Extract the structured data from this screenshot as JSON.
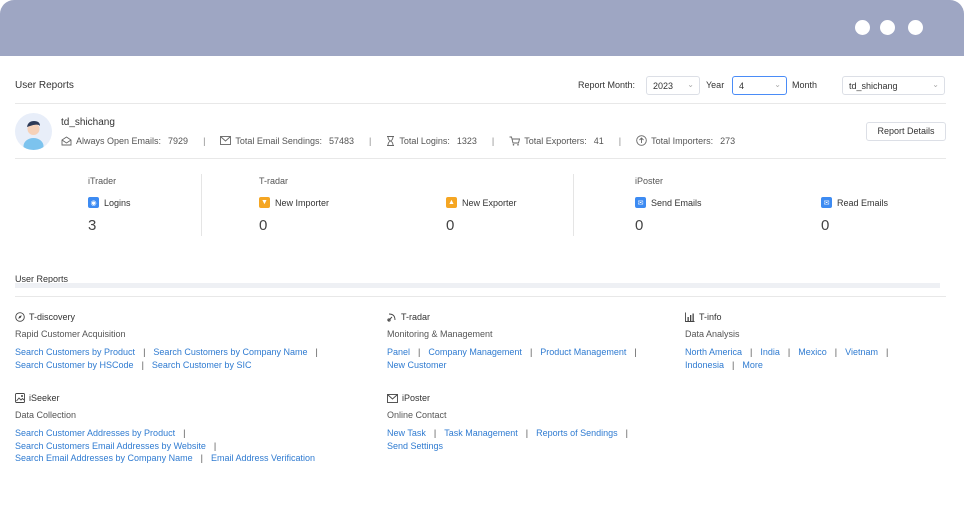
{
  "header": {
    "title": "User Reports",
    "report_month_label": "Report Month:",
    "year_value": "2023",
    "year_label": "Year",
    "month_value": "4",
    "month_label": "Month",
    "user_value": "td_shichang"
  },
  "user": {
    "name": "td_shichang",
    "stats": [
      {
        "label": "Always Open Emails:",
        "value": "7929",
        "icon": "envelope-open-icon"
      },
      {
        "label": "Total Email Sendings:",
        "value": "57483",
        "icon": "envelope-icon"
      },
      {
        "label": "Total Logins:",
        "value": "1323",
        "icon": "hourglass-icon"
      },
      {
        "label": "Total Exporters:",
        "value": "41",
        "icon": "cart-icon"
      },
      {
        "label": "Total Importers:",
        "value": "273",
        "icon": "upload-circle-icon"
      }
    ],
    "report_details_button": "Report Details"
  },
  "metrics": {
    "groups": [
      "iTrader",
      "T-radar",
      "iPoster"
    ],
    "items": [
      {
        "label": "Logins",
        "value": "3",
        "color": "#3d8bf2"
      },
      {
        "label": "New Importer",
        "value": "0",
        "color": "#f5a623"
      },
      {
        "label": "New Exporter",
        "value": "0",
        "color": "#f5a623"
      },
      {
        "label": "Send Emails",
        "value": "0",
        "color": "#3d8bf2"
      },
      {
        "label": "Read Emails",
        "value": "0",
        "color": "#3d8bf2"
      }
    ]
  },
  "section2": {
    "title": "User Reports"
  },
  "modules": {
    "tdiscovery": {
      "title": "T-discovery",
      "subtitle": "Rapid Customer Acquisition",
      "links": [
        "Search Customers by Product",
        "Search Customers by Company Name",
        "Search Customer by HSCode",
        "Search Customer by SIC"
      ]
    },
    "tradar": {
      "title": "T-radar",
      "subtitle": "Monitoring & Management",
      "links": [
        "Panel",
        "Company Management",
        "Product Management",
        "New Customer"
      ]
    },
    "tinfo": {
      "title": "T-info",
      "subtitle": "Data Analysis",
      "links": [
        "North America",
        "India",
        "Mexico",
        "Vietnam",
        "Indonesia",
        "More"
      ]
    },
    "iseeker": {
      "title": "iSeeker",
      "subtitle": "Data Collection",
      "links": [
        "Search Customer Addresses by Product",
        "Search Customers Email Addresses by Website",
        "Search Email Addresses by Company Name",
        "Email Address Verification"
      ]
    },
    "iposter": {
      "title": "iPoster",
      "subtitle": "Online Contact",
      "links": [
        "New Task",
        "Task Management",
        "Reports of Sendings",
        "Send Settings"
      ]
    }
  }
}
